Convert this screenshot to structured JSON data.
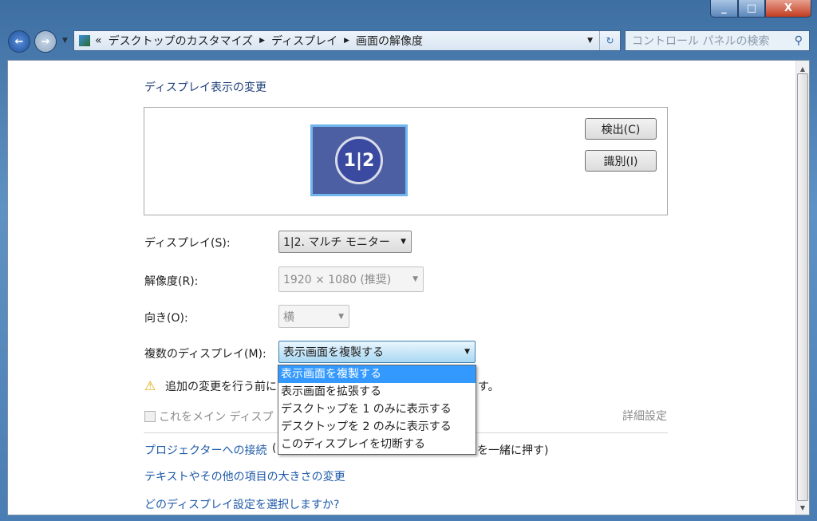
{
  "window": {
    "minimize": "_",
    "maximize": "□",
    "close": "X"
  },
  "nav": {
    "back": "←",
    "forward": "→"
  },
  "address": {
    "prefix": "«",
    "crumbs": [
      "デスクトップのカスタマイズ",
      "ディスプレイ",
      "画面の解像度"
    ]
  },
  "search": {
    "placeholder": "コントロール パネルの検索"
  },
  "page": {
    "title": "ディスプレイ表示の変更",
    "detect_button": "検出(C)",
    "identify_button": "識別(I)",
    "monitor_label": "1|2",
    "display_label": "ディスプレイ(S):",
    "display_value": "1|2. マルチ モニター",
    "resolution_label": "解像度(R):",
    "resolution_value": "1920 × 1080 (推奨)",
    "orientation_label": "向き(O):",
    "orientation_value": "横",
    "multi_label": "複数のディスプレイ(M):",
    "multi_value": "表示画面を複製する",
    "multi_options": [
      "表示画面を複製する",
      "表示画面を拡張する",
      "デスクトップを 1 のみに表示する",
      "デスクトップを 2 のみに表示する",
      "このディスプレイを切断する"
    ],
    "warning_start": "追加の変更を行う前に",
    "warning_end": "す。",
    "main_display_checkbox": "これをメイン ディスプ",
    "advanced_link": "詳細設定",
    "projector_link": "プロジェクターへの接続",
    "projector_start": " (",
    "projector_end": "を一緒に押す)",
    "text_size_link": "テキストやその他の項目の大きさの変更",
    "which_settings_link": "どのディスプレイ設定を選択しますか?"
  }
}
